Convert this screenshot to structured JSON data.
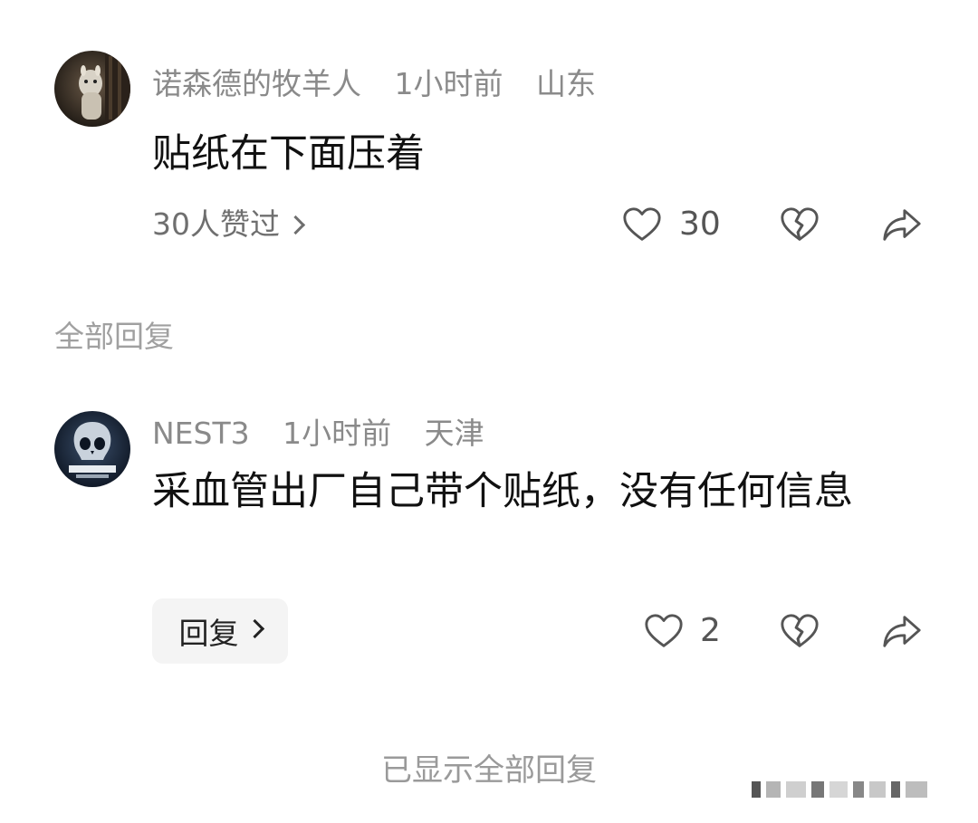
{
  "comments": [
    {
      "username": "诺森德的牧羊人",
      "time": "1小时前",
      "location": "山东",
      "content": "贴纸在下面压着",
      "likes_summary": "30人赞过",
      "like_count": "30",
      "avatar_icon": "alpaca-avatar"
    }
  ],
  "section_label": "全部回复",
  "replies": [
    {
      "username": "NEST3",
      "time": "1小时前",
      "location": "天津",
      "content": "采血管出厂自己带个贴纸，没有任何信息",
      "reply_button_label": "回复",
      "like_count": "2",
      "avatar_icon": "call-of-duty-skull-avatar"
    }
  ],
  "footer_text": "已显示全部回复",
  "colors": {
    "meta_text": "#8a8a8a",
    "content_text": "#111111",
    "icon_stroke": "#555555",
    "reply_button_bg": "#f4f4f4"
  }
}
